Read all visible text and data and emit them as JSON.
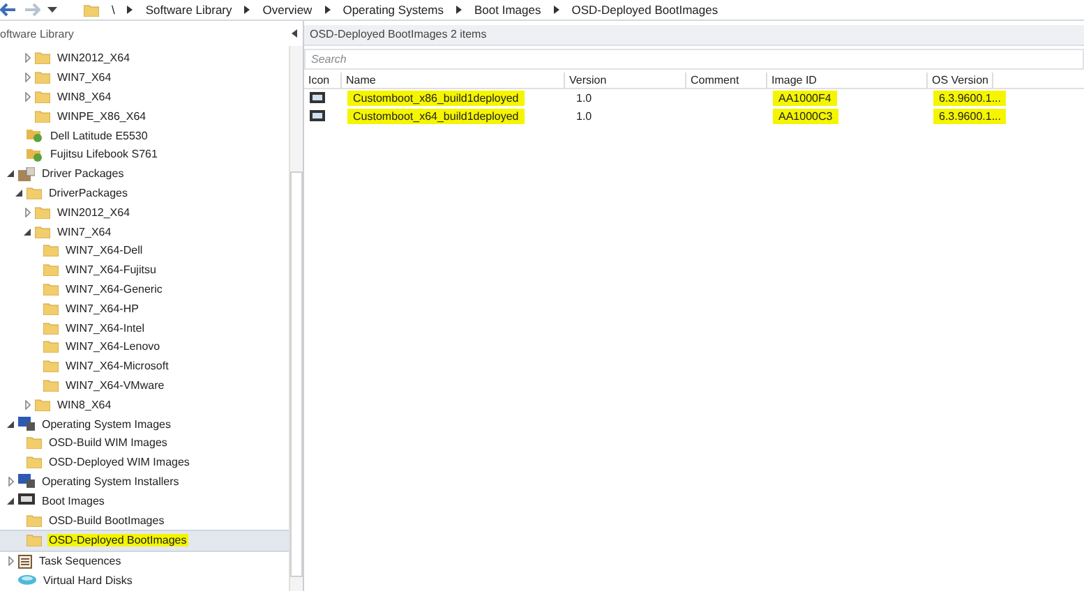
{
  "breadcrumb": {
    "root": "\\",
    "items": [
      "Software Library",
      "Overview",
      "Operating Systems",
      "Boot Images",
      "OSD-Deployed BootImages"
    ]
  },
  "navigation": {
    "title": "oftware Library",
    "tree": [
      {
        "children": [
          {
            "children": [
              {
                "label": "WIN2012_X64",
                "kind": "folder",
                "expanded": false,
                "selected": false,
                "highlighted": false
              },
              {
                "label": "WIN7_X64",
                "kind": "folder",
                "expanded": false,
                "selected": false,
                "highlighted": false
              },
              {
                "label": "WIN8_X64",
                "kind": "folder",
                "expanded": false,
                "selected": false,
                "highlighted": false
              },
              {
                "label": "WINPE_X86_X64",
                "kind": "folder",
                "selected": false,
                "highlighted": false
              }
            ]
          },
          {
            "label": "Dell Latitude E5530",
            "kind": "package",
            "selected": false,
            "highlighted": false
          },
          {
            "label": "Fujitsu Lifebook S761",
            "kind": "package",
            "selected": false,
            "highlighted": false
          }
        ]
      },
      {
        "label": "Driver Packages",
        "kind": "drivers",
        "expanded": true,
        "selected": false,
        "highlighted": false,
        "children": [
          {
            "label": "DriverPackages",
            "kind": "folder",
            "expanded": true,
            "selected": false,
            "highlighted": false,
            "children": [
              {
                "label": "WIN2012_X64",
                "kind": "folder",
                "expanded": false,
                "selected": false,
                "highlighted": false
              },
              {
                "label": "WIN7_X64",
                "kind": "folder",
                "expanded": true,
                "selected": false,
                "highlighted": false,
                "children": [
                  {
                    "label": "WIN7_X64-Dell",
                    "kind": "folder",
                    "selected": false,
                    "highlighted": false
                  },
                  {
                    "label": "WIN7_X64-Fujitsu",
                    "kind": "folder",
                    "selected": false,
                    "highlighted": false
                  },
                  {
                    "label": "WIN7_X64-Generic",
                    "kind": "folder",
                    "selected": false,
                    "highlighted": false
                  },
                  {
                    "label": "WIN7_X64-HP",
                    "kind": "folder",
                    "selected": false,
                    "highlighted": false
                  },
                  {
                    "label": "WIN7_X64-Intel",
                    "kind": "folder",
                    "selected": false,
                    "highlighted": false
                  },
                  {
                    "label": "WIN7_X64-Lenovo",
                    "kind": "folder",
                    "selected": false,
                    "highlighted": false
                  },
                  {
                    "label": "WIN7_X64-Microsoft",
                    "kind": "folder",
                    "selected": false,
                    "highlighted": false
                  },
                  {
                    "label": "WIN7_X64-VMware",
                    "kind": "folder",
                    "selected": false,
                    "highlighted": false
                  }
                ]
              },
              {
                "label": "WIN8_X64",
                "kind": "folder",
                "expanded": false,
                "selected": false,
                "highlighted": false
              }
            ]
          }
        ]
      },
      {
        "label": "Operating System Images",
        "kind": "os",
        "expanded": true,
        "selected": false,
        "highlighted": false,
        "children": [
          {
            "label": "OSD-Build WIM Images",
            "kind": "folder",
            "selected": false,
            "highlighted": false
          },
          {
            "label": "OSD-Deployed WIM Images",
            "kind": "folder",
            "selected": false,
            "highlighted": false
          }
        ]
      },
      {
        "label": "Operating System Installers",
        "kind": "os",
        "expanded": false,
        "selected": false,
        "highlighted": false
      },
      {
        "label": "Boot Images",
        "kind": "boot",
        "expanded": true,
        "selected": false,
        "highlighted": false,
        "children": [
          {
            "label": "OSD-Build BootImages",
            "kind": "folder",
            "selected": false,
            "highlighted": false
          },
          {
            "label": "OSD-Deployed BootImages",
            "kind": "folder",
            "selected": true,
            "highlighted": true
          }
        ]
      },
      {
        "label": "Task Sequences",
        "kind": "tasks",
        "expanded": false,
        "selected": false,
        "highlighted": false
      },
      {
        "label": "Virtual Hard Disks",
        "kind": "vhd",
        "selected": false,
        "highlighted": false
      }
    ]
  },
  "list": {
    "title": "OSD-Deployed BootImages 2 items",
    "search": {
      "placeholder": "Search"
    },
    "columns": [
      "Icon",
      "Name",
      "Version",
      "Comment",
      "Image ID",
      "OS Version"
    ],
    "rows": [
      {
        "name": {
          "text": "Customboot_x86_build1deployed",
          "highlighted": true
        },
        "version": {
          "text": "1.0",
          "highlighted": false
        },
        "image_id": {
          "text": "AA1000F4",
          "highlighted": true
        },
        "os_version": {
          "text": "6.3.9600.1...",
          "highlighted": true
        }
      },
      {
        "name": {
          "text": "Customboot_x64_build1deployed",
          "highlighted": true
        },
        "version": {
          "text": "1.0",
          "highlighted": false
        },
        "image_id": {
          "text": "AA1000C3",
          "highlighted": true
        },
        "os_version": {
          "text": "6.3.9600.1...",
          "highlighted": true
        }
      }
    ]
  }
}
